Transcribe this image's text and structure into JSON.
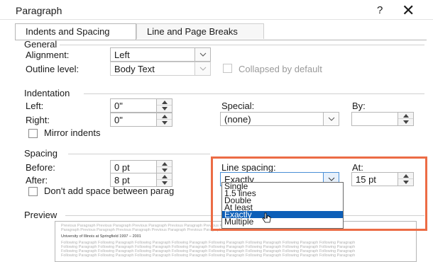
{
  "window": {
    "title": "Paragraph",
    "help": "?",
    "close": "✕"
  },
  "tabs": [
    {
      "label": "Indents and Spacing"
    },
    {
      "label": "Line and Page Breaks"
    }
  ],
  "general": {
    "heading": "General",
    "alignment_label": "Alignment:",
    "alignment_value": "Left",
    "outline_label": "Outline level:",
    "outline_value": "Body Text",
    "collapsed_label": "Collapsed by default"
  },
  "indentation": {
    "heading": "Indentation",
    "left_label": "Left:",
    "left_value": "0\"",
    "right_label": "Right:",
    "right_value": "0\"",
    "special_label": "Special:",
    "special_value": "(none)",
    "by_label": "By:",
    "by_value": "",
    "mirror_label": "Mirror indents"
  },
  "spacing": {
    "heading": "Spacing",
    "before_label": "Before:",
    "before_value": "0 pt",
    "after_label": "After:",
    "after_value": "8 pt",
    "dont_add_label": "Don't add space between parag",
    "line_spacing_label": "Line spacing:",
    "line_spacing_value": "Exactly",
    "at_label": "At:",
    "at_value": "15 pt",
    "options": [
      "Single",
      "1.5 lines",
      "Double",
      "At least",
      "Exactly",
      "Multiple"
    ],
    "selected_index": 4
  },
  "preview": {
    "heading": "Preview",
    "prev_text": "Previous Paragraph Previous Paragraph Previous Paragraph Previous Paragraph Previous Paragraph Previous Paragraph Previous Paragraph",
    "prev_text2": "Paragraph Previous Paragraph Previous Paragraph Previous Paragraph Previous Paragraph",
    "sample_text": "University of Illinois at Springfield 1997 – 2001",
    "follow_text": "Following Paragraph Following Paragraph Following Paragraph Following Paragraph Following Paragraph Following Paragraph Following Paragraph Following Paragraph"
  }
}
